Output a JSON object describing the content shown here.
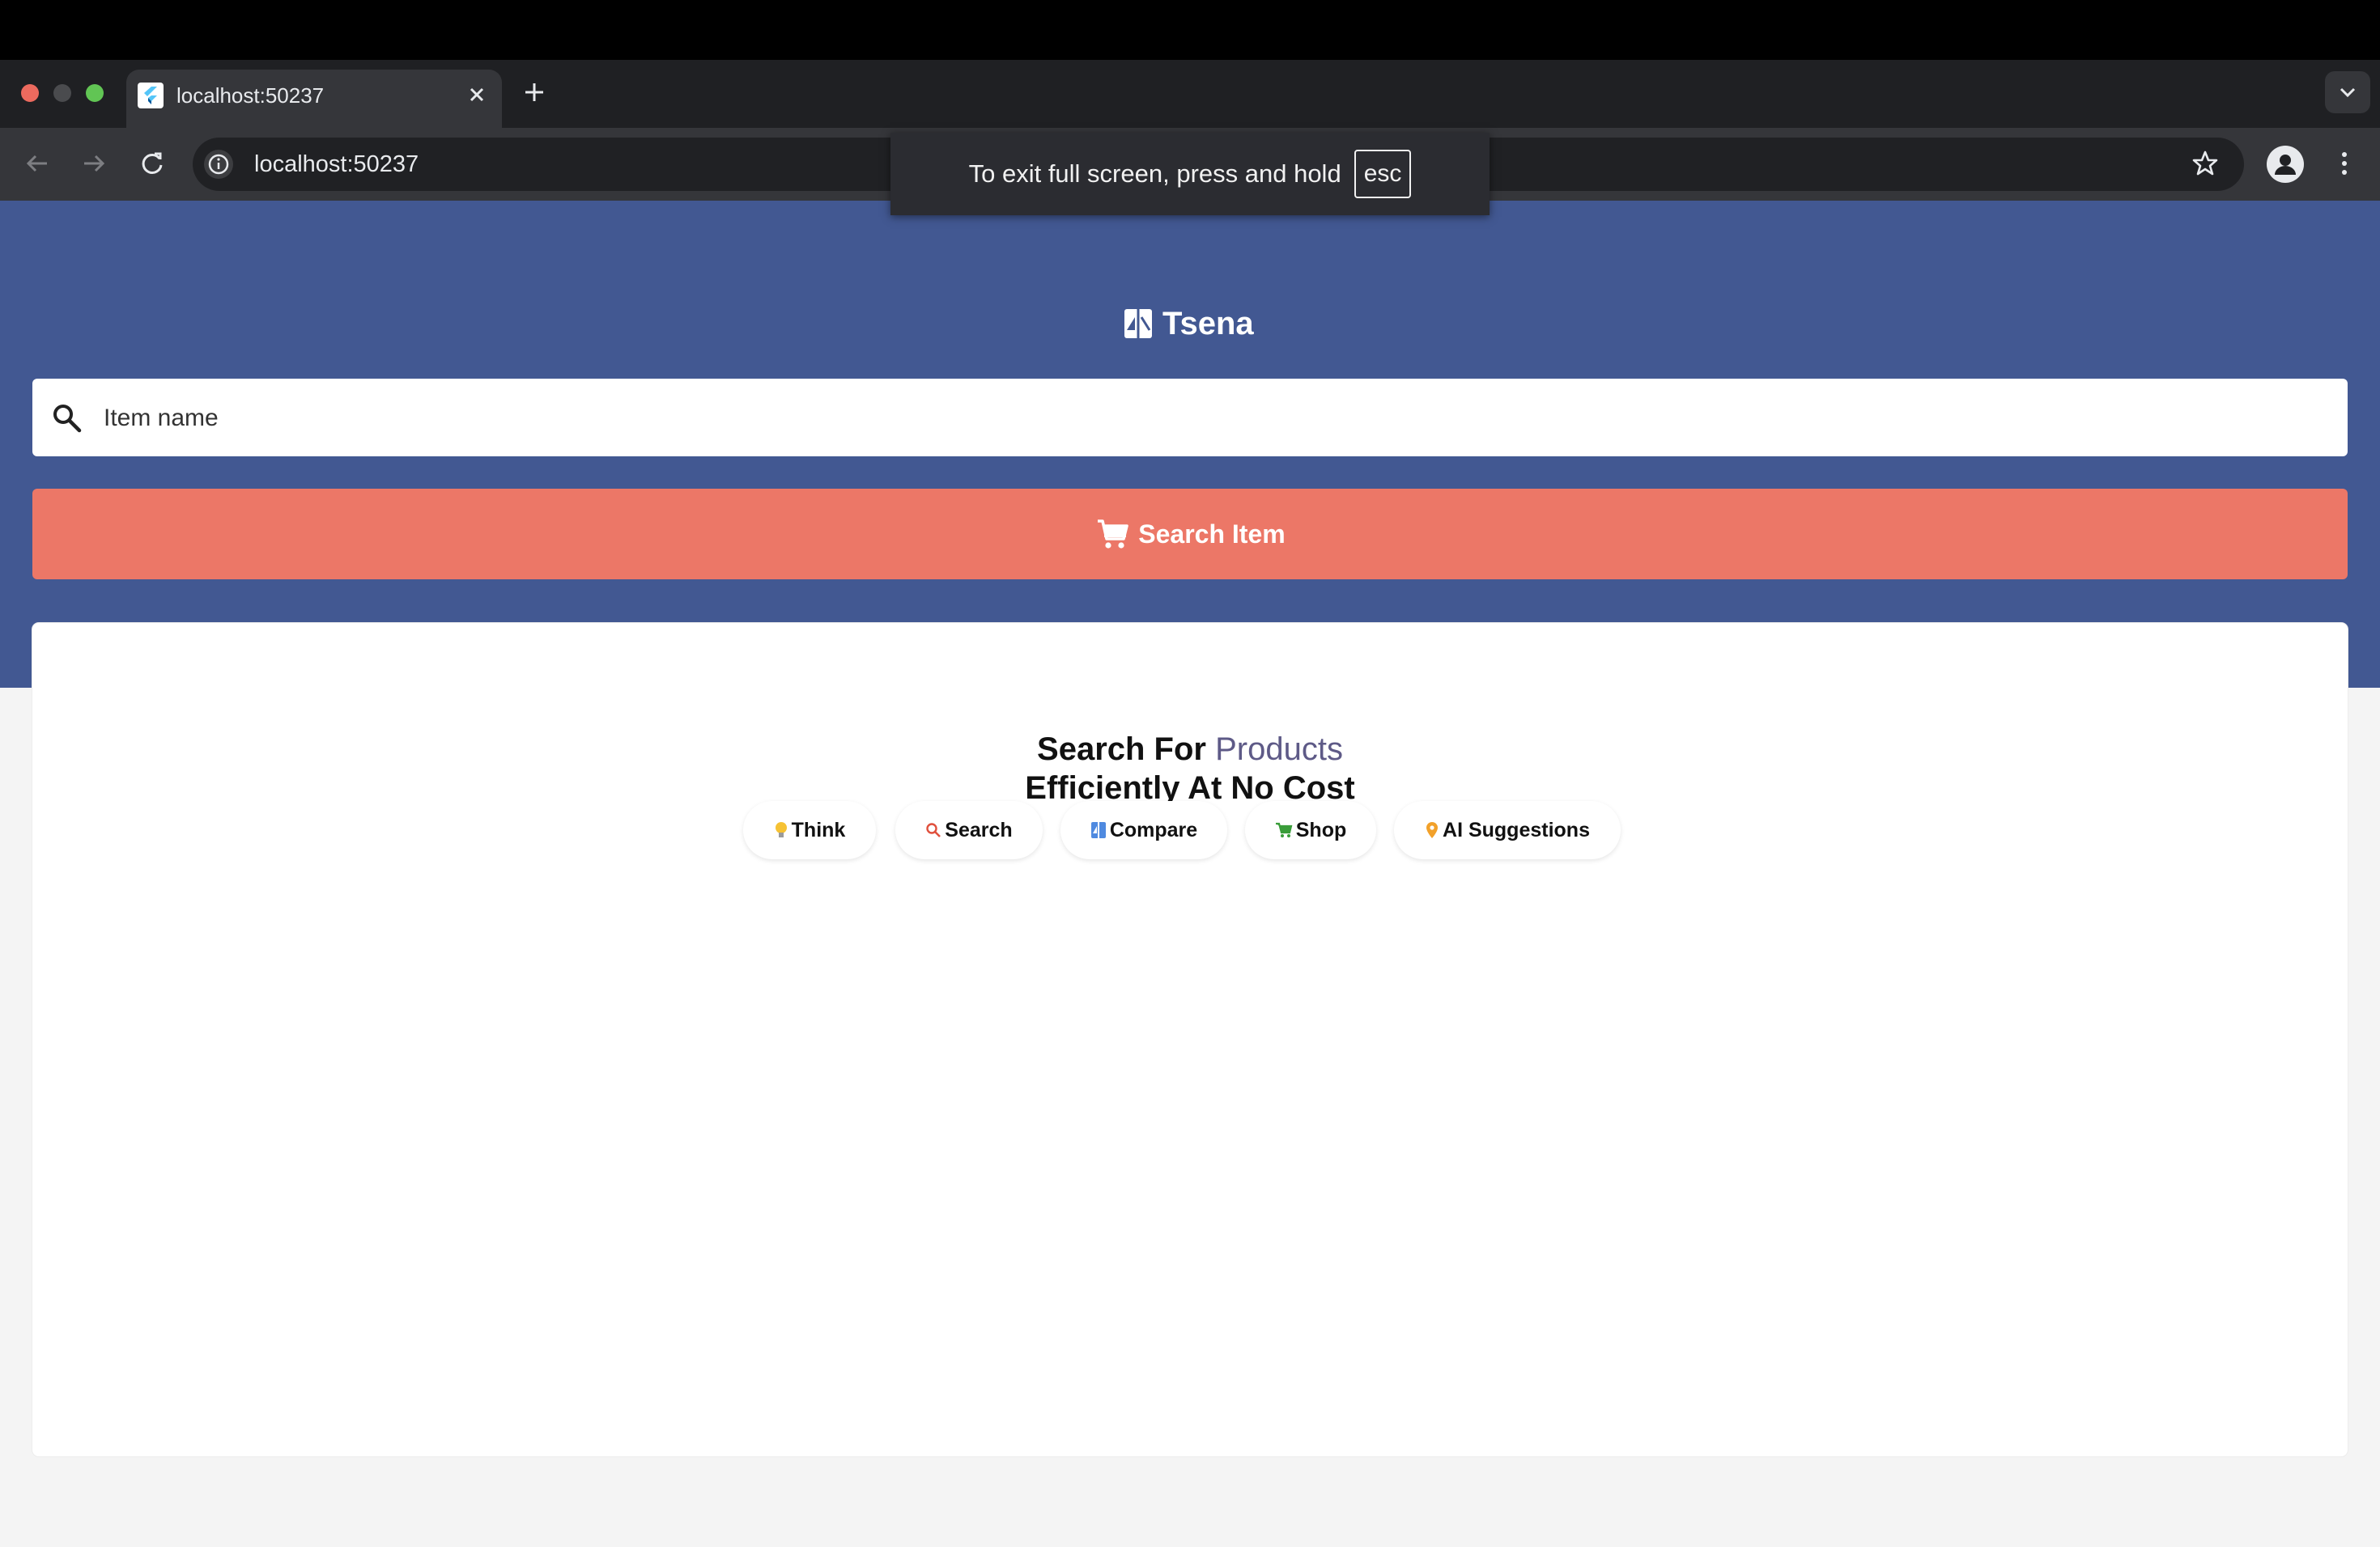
{
  "browser": {
    "tab_title": "localhost:50237",
    "url": "localhost:50237",
    "fullscreen_notice": "To exit full screen, press and hold",
    "esc_key": "esc"
  },
  "app": {
    "brand": "Tsena",
    "search": {
      "placeholder": "Item name"
    },
    "search_button": "Search Item",
    "headline": {
      "line1_prefix": "Search For",
      "line1_accent": "Products",
      "line2": "Efficiently At No Cost"
    },
    "chips": [
      {
        "label": "Think",
        "icon": "lightbulb-icon"
      },
      {
        "label": "Search",
        "icon": "search-icon"
      },
      {
        "label": "Compare",
        "icon": "compare-icon"
      },
      {
        "label": "Shop",
        "icon": "cart-icon"
      },
      {
        "label": "AI Suggestions",
        "icon": "pin-icon"
      }
    ]
  },
  "colors": {
    "hero": "#425892",
    "button": "#ec7767",
    "accent_text": "#5e5a87",
    "page_bg": "#f4f4f4"
  }
}
